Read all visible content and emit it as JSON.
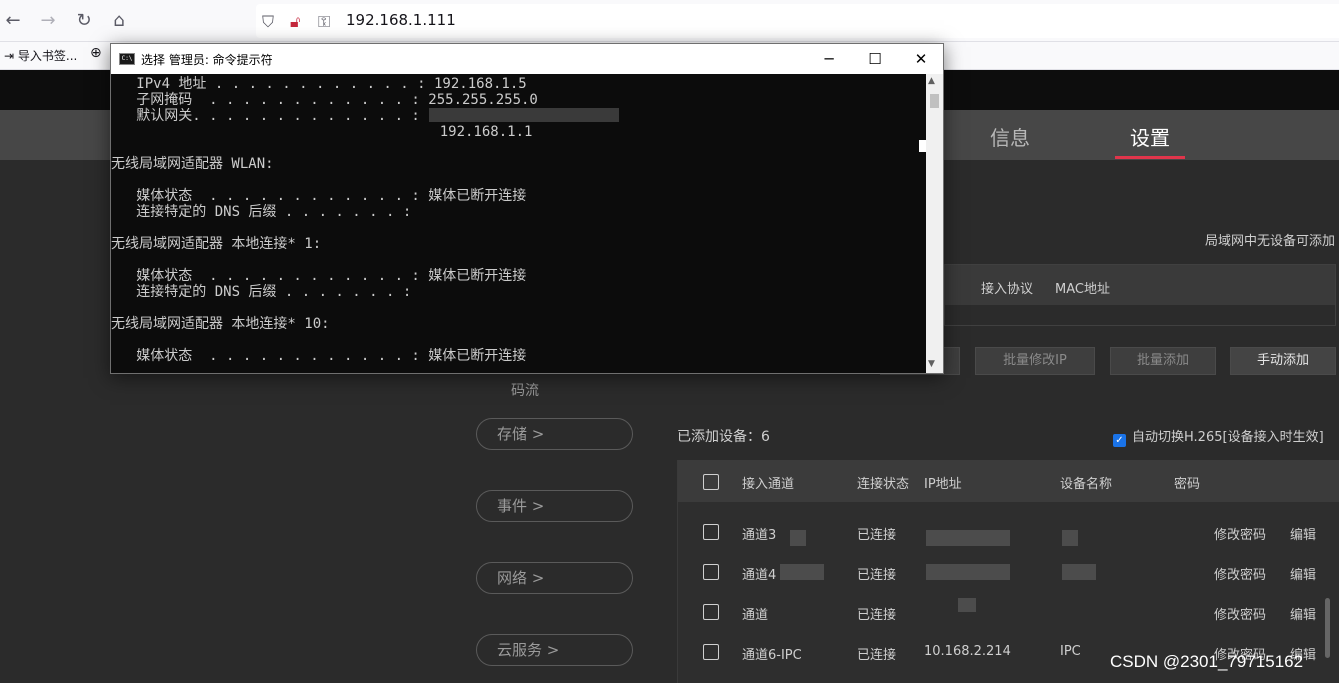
{
  "browser": {
    "url": "192.168.1.111",
    "bookmarks": {
      "import_label": "导入书签..."
    }
  },
  "app": {
    "nav_tabs": [
      {
        "label": "信息"
      },
      {
        "label": "设置"
      }
    ],
    "lan_note": "局域网中无设备可添加",
    "scan_columns": [
      "接入协议",
      "MAC地址"
    ],
    "buttons": {
      "batch_modify_ip": "批量修改IP",
      "batch_add": "批量添加",
      "manual_add": "手动添加"
    },
    "sidebar": {
      "stream_label": "码流",
      "items": [
        {
          "label": "存储 >"
        },
        {
          "label": "事件 >"
        },
        {
          "label": "网络 >"
        },
        {
          "label": "云服务 >"
        }
      ]
    },
    "added_devices": "已添加设备：6",
    "auto_switch": "自动切换H.265[设备接入时生效]",
    "device_columns": [
      "接入通道",
      "连接状态",
      "IP地址",
      "设备名称",
      "密码"
    ],
    "devices": [
      {
        "channel": "通道3",
        "status": "已连接",
        "ip": "",
        "name": "",
        "modify": "修改密码",
        "edit": "编辑"
      },
      {
        "channel": "通道4",
        "status": "已连接",
        "ip": "",
        "name": "",
        "modify": "修改密码",
        "edit": "编辑"
      },
      {
        "channel": "通道",
        "status": "已连接",
        "ip": "",
        "name": "",
        "modify": "修改密码",
        "edit": "编辑"
      },
      {
        "channel": "通道6-IPC",
        "status": "已连接",
        "ip": "10.168.2.214",
        "name": "IPC",
        "modify": "修改密码",
        "edit": "编辑"
      }
    ],
    "watermark": "CSDN @2301_79715162"
  },
  "cmd": {
    "title": "选择 管理员: 命令提示符",
    "lines": [
      "   IPv4 地址 . . . . . . . . . . . . : 192.168.1.5",
      "   子网掩码  . . . . . . . . . . . . : 255.255.255.0",
      "   默认网关. . . . . . . . . . . . . :",
      "                                       192.168.1.1",
      "",
      "无线局域网适配器 WLAN:",
      "",
      "   媒体状态  . . . . . . . . . . . . : 媒体已断开连接",
      "   连接特定的 DNS 后缀 . . . . . . . :",
      "",
      "无线局域网适配器 本地连接* 1:",
      "",
      "   媒体状态  . . . . . . . . . . . . : 媒体已断开连接",
      "   连接特定的 DNS 后缀 . . . . . . . :",
      "",
      "无线局域网适配器 本地连接* 10:",
      "",
      "   媒体状态  . . . . . . . . . . . . : 媒体已断开连接"
    ]
  }
}
